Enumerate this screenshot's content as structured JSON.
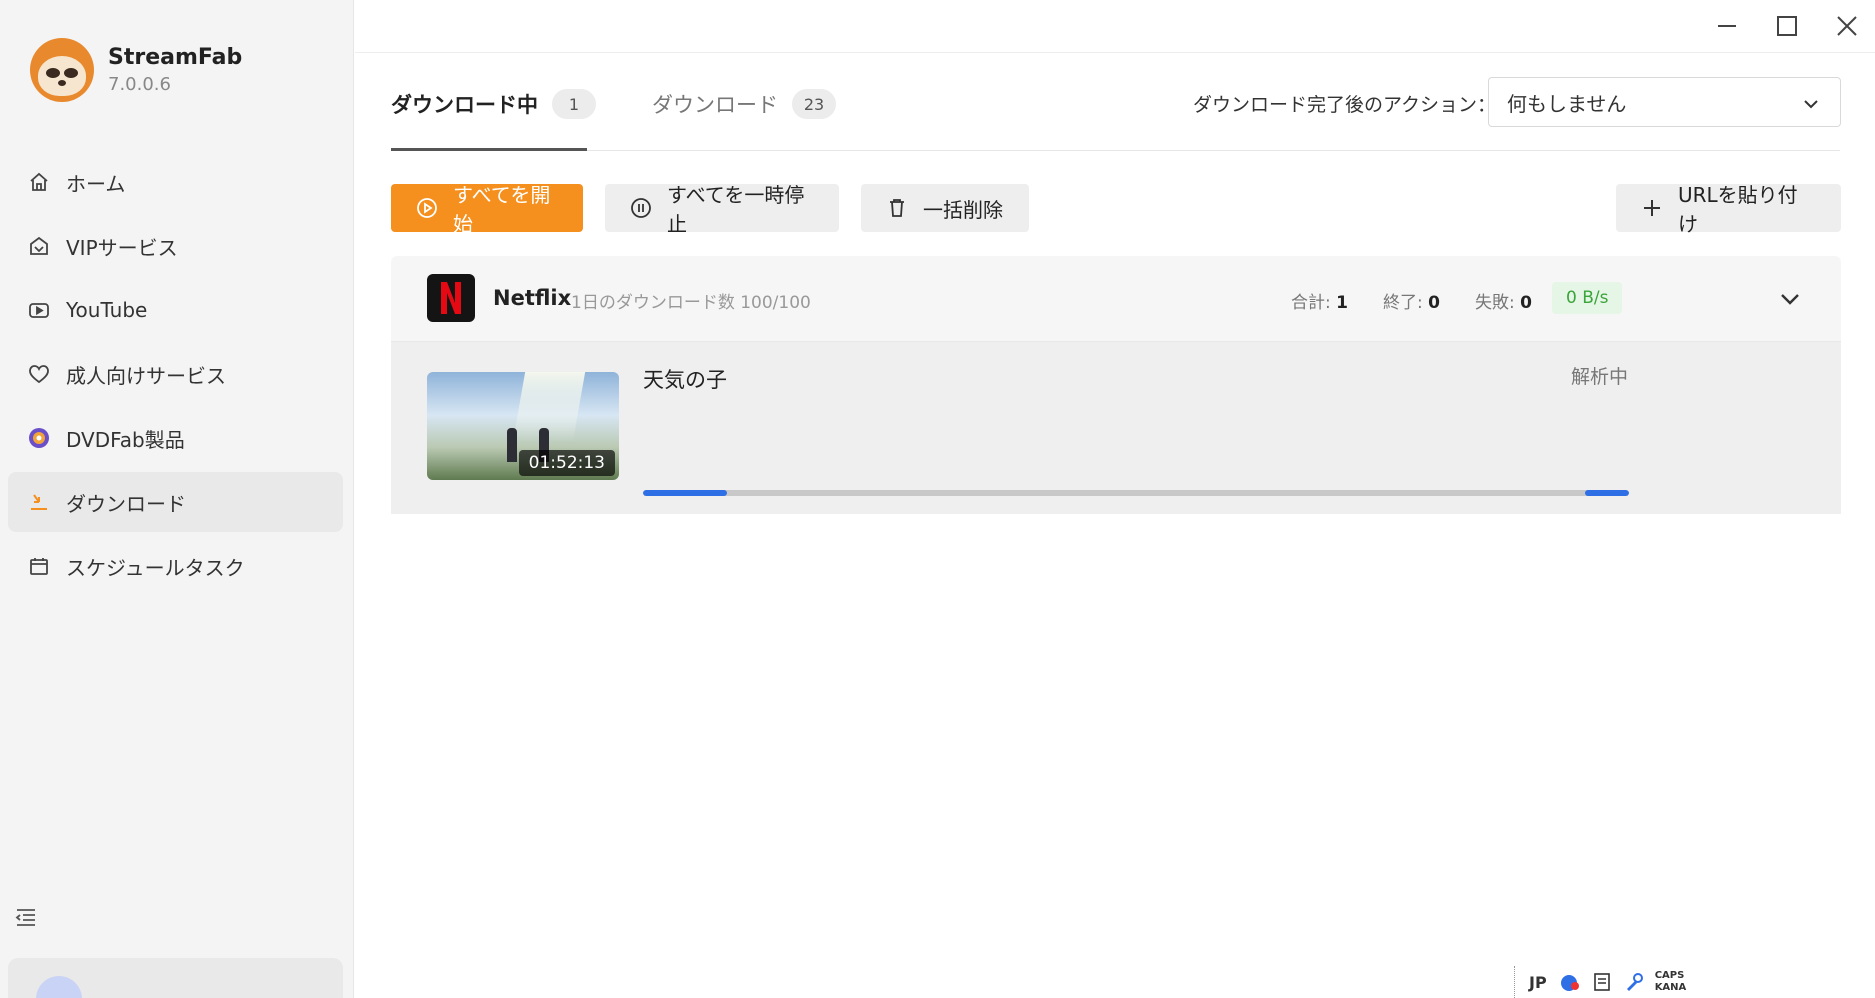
{
  "app": {
    "name": "StreamFab",
    "version": "7.0.0.6"
  },
  "sidebar": {
    "items": [
      {
        "label": "ホーム",
        "icon": "home-icon"
      },
      {
        "label": "VIPサービス",
        "icon": "vip-icon"
      },
      {
        "label": "YouTube",
        "icon": "youtube-icon"
      },
      {
        "label": "成人向けサービス",
        "icon": "heart-icon"
      },
      {
        "label": "DVDFab製品",
        "icon": "dvdfab-icon"
      },
      {
        "label": "ダウンロード",
        "icon": "download-icon",
        "active": true
      },
      {
        "label": "スケジュールタスク",
        "icon": "calendar-icon"
      }
    ]
  },
  "tabs": [
    {
      "label": "ダウンロード中",
      "count": "1",
      "active": true
    },
    {
      "label": "ダウンロード",
      "count": "23",
      "active": false
    }
  ],
  "after_action": {
    "label": "ダウンロード完了後のアクション：",
    "value": "何もしません"
  },
  "toolbar": {
    "start_all": "すべてを開始",
    "pause_all": "すべてを一時停止",
    "delete_all": "一括削除",
    "paste_url": "URLを貼り付け"
  },
  "group": {
    "service": "Netflix",
    "quota": "1日のダウンロード数 100/100",
    "total_label": "合計:",
    "total": "1",
    "done_label": "終了:",
    "done": "0",
    "failed_label": "失敗:",
    "failed": "0",
    "speed": "0 B/s"
  },
  "item": {
    "title": "天気の子",
    "duration": "01:52:13",
    "status": "解析中"
  },
  "tray": {
    "ime": "JP",
    "caps": "CAPS",
    "kana": "KANA"
  },
  "colors": {
    "accent": "#f5901e",
    "progress": "#2f6fe6",
    "speed_text": "#3aa53a",
    "netflix": "#e50914"
  }
}
